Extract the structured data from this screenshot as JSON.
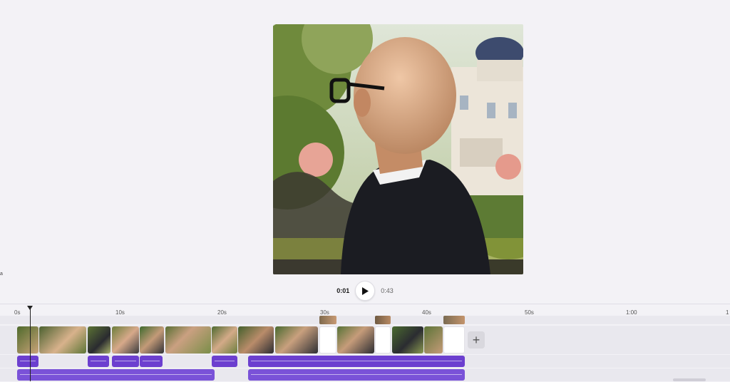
{
  "player": {
    "current_time": "0:01",
    "total_time": "0:43"
  },
  "timeline": {
    "ruler_labels": [
      "0s",
      "10s",
      "20s",
      "30s",
      "40s",
      "50s",
      "1:00",
      "1"
    ]
  },
  "colors": {
    "accent_audio": "#6c3fcf",
    "background": "#f3f2f6"
  },
  "icons": {
    "play": "play-icon",
    "add": "plus-icon",
    "playhead": "playhead-marker-icon"
  },
  "add_button_label": "+"
}
